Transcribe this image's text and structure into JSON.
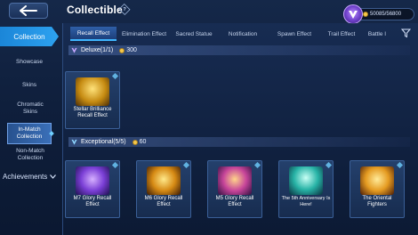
{
  "header": {
    "title": "Collectible",
    "currency_value": "50085/56800"
  },
  "sidebar": {
    "collection_label": "Collection",
    "items": [
      {
        "label": "Showcase"
      },
      {
        "label": "Skins"
      },
      {
        "label": "Chromatic Skins"
      },
      {
        "label": "In-Match Collection"
      },
      {
        "label": "Non-Match Collection"
      }
    ],
    "achievements_label": "Achievements"
  },
  "tabs": [
    {
      "label": "Recall Effect"
    },
    {
      "label": "Elimination Effect"
    },
    {
      "label": "Sacred Statue"
    },
    {
      "label": "Notification"
    },
    {
      "label": "Spawn Effect"
    },
    {
      "label": "Trail Effect"
    },
    {
      "label": "Battle I"
    }
  ],
  "sections": {
    "deluxe": {
      "title": "Deluxe(1/1)",
      "points": "300",
      "items": [
        {
          "label": "Stellar Brilliance Recall Effect"
        }
      ]
    },
    "exceptional": {
      "title": "Exceptional(5/5)",
      "points": "60",
      "items": [
        {
          "label": "M7 Glory Recall Effect"
        },
        {
          "label": "M6 Glory Recall Effect"
        },
        {
          "label": "M5 Glory Recall Effect"
        },
        {
          "label": "The 5th Anniversary Is Here!"
        },
        {
          "label": "The Oriental Fighters"
        }
      ]
    }
  },
  "colors": {
    "accent": "#2da2f0",
    "background": "#0f1f3c",
    "gold": "#f4c74a"
  },
  "icons": {
    "back": "back-arrow-icon",
    "help": "help-diamond-icon",
    "filter": "filter-icon",
    "coin": "coin-icon",
    "badge": "rank-badge-icon"
  }
}
